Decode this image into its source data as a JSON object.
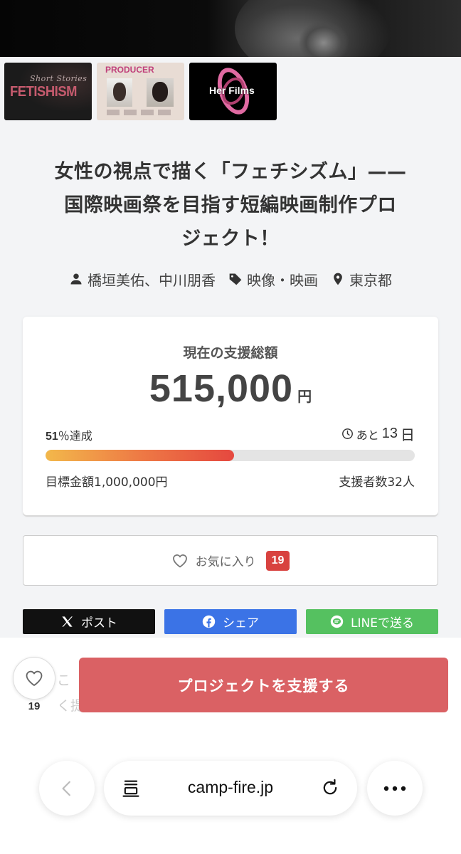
{
  "thumbnails": [
    {
      "script": "Short Stories",
      "title": "FETISHISM"
    },
    {
      "title": "PRODUCER"
    },
    {
      "title": "Her Films"
    }
  ],
  "project": {
    "title_lines": [
      "女性の視点で描く「フェチシズム」——",
      "国際映画祭を目指す短編映画制作プロ",
      "ジェクト！"
    ],
    "owners": "橋垣美佑、中川朋香",
    "category": "映像・映画",
    "location": "東京都"
  },
  "funding": {
    "label": "現在の支援総額",
    "amount": "515,000",
    "currency": "円",
    "percent_value": "51",
    "percent_suffix": "％達成",
    "percent": 51,
    "remaining_prefix": "あと",
    "remaining_days": "13",
    "remaining_suffix": "日",
    "goal": "目標金額1,000,000円",
    "backers": "支援者数32人"
  },
  "favorite": {
    "label": "お気に入り",
    "count": "19"
  },
  "share": {
    "x_label": "ポスト",
    "facebook_label": "シェア",
    "line_label": "LINEで送る"
  },
  "sticky": {
    "behind_text_1": "こ",
    "behind_text_2": "く提",
    "heart_count": "19",
    "support_label": "プロジェクトを支援する"
  },
  "browser": {
    "url": "camp-fire.jp"
  },
  "colors": {
    "support_button": "#da6164",
    "badge": "#d8423f",
    "x": "#111111",
    "facebook": "#3b73e6",
    "line": "#55c160",
    "progress_start": "#f2b84b",
    "progress_end": "#e5483f"
  },
  "icons": {
    "owner": "user-icon",
    "category": "tag-icon",
    "location": "pin-icon",
    "remaining": "clock-icon",
    "favorite": "heart-icon",
    "back": "chevron-left-icon",
    "tabs": "tabs-icon",
    "reload": "reload-icon",
    "more": "more-icon"
  }
}
